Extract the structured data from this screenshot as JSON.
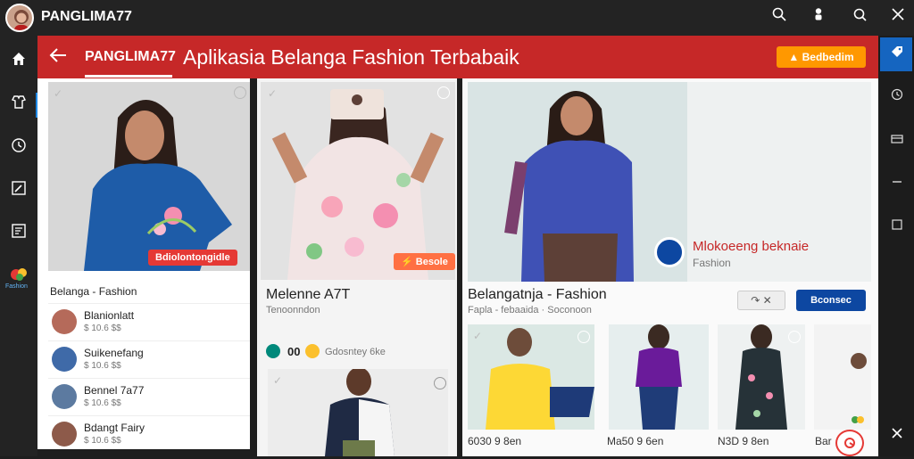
{
  "topbar": {
    "title": "PANGLIMA77",
    "icons": [
      "search-icon",
      "person-icon",
      "search-icon",
      "close-icon"
    ]
  },
  "leftrail": {
    "icons": [
      "home-icon",
      "fashion-icon",
      "clock-icon",
      "edit-icon",
      "image-icon"
    ],
    "brand_label": "Fashion"
  },
  "header": {
    "brand": "PANGLIMA77",
    "title": "Aplikasia Belanga Fashion Terbabaik",
    "cta_label": "Bedbedim"
  },
  "card1": {
    "tag": "Bdiolontongidle",
    "title": "Belanga - Fashion"
  },
  "list": [
    {
      "name": "Blanionlatt",
      "meta": "$ 10.6 $$"
    },
    {
      "name": "Suikenefang",
      "meta": "$ 10.6 $$"
    },
    {
      "name": "Bennel 7a77",
      "meta": "$ 10.6 $$"
    },
    {
      "name": "Bdangt Fairy",
      "meta": "$ 10.6 $$"
    }
  ],
  "card2": {
    "tag": "Besole",
    "title": "Melenne A7T",
    "subtitle": "Tenoonndon",
    "rating": "00",
    "meta": "Gdosntey 6ke"
  },
  "hero": {
    "overlay_title": "Mlokoeeng beknaie",
    "overlay_sub": "Fashion"
  },
  "detail": {
    "title": "Belangatnja - Fashion",
    "meta": "Fapla - febaaida  ·  Soconoon",
    "share_label": "↷ ✕",
    "action_label": "Bconsec"
  },
  "thumbs": [
    {
      "caption": "6030 9 8en"
    },
    {
      "caption": "Ma50 9 6en"
    },
    {
      "caption": "N3D 9 8en"
    },
    {
      "caption": "Bar"
    }
  ],
  "colors": {
    "header": "#c62828",
    "accent": "#ff9800",
    "link": "#1565c0"
  }
}
